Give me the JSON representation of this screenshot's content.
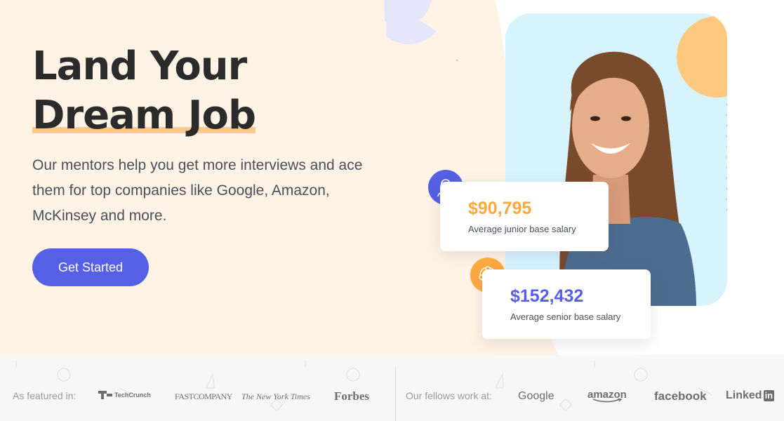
{
  "hero": {
    "headline_line1": "Land Your",
    "headline_line2": "Dream Job",
    "subtitle": "Our mentors help you get more interviews and ace them for top companies like Google, Amazon, McKinsey and more.",
    "cta_label": "Get Started"
  },
  "stats": [
    {
      "amount": "$90,795",
      "label": "Average junior base salary",
      "icon": "mentor-person-icon",
      "color": "#fba941"
    },
    {
      "amount": "$152,432",
      "label": "Average senior base salary",
      "icon": "team-network-icon",
      "color": "#5660e6"
    }
  ],
  "featured": {
    "label": "As featured in:",
    "logos": [
      "TechCrunch",
      "FASTCOMPANY",
      "The New York Times",
      "Forbes"
    ]
  },
  "fellows": {
    "label": "Our fellows work at:",
    "logos": [
      "Google",
      "amazon",
      "facebook",
      "Linked",
      "in"
    ]
  },
  "colors": {
    "accent": "#5660e6",
    "orange": "#fba941",
    "hero_bg": "#fff3e6",
    "photo_bg": "#d7f3fc"
  }
}
